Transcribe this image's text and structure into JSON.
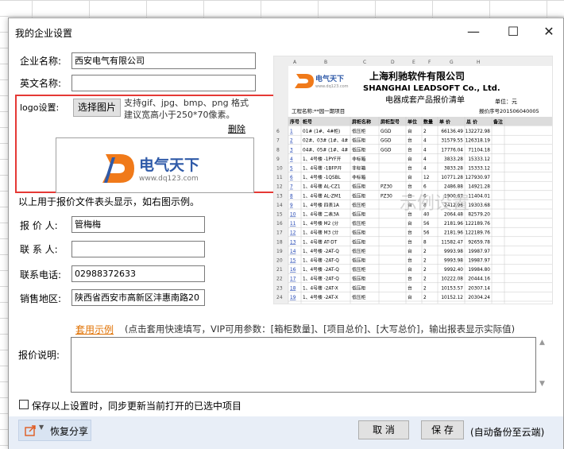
{
  "dialog": {
    "title": "我的企业设置",
    "minimize": "—",
    "maximize": "☐",
    "close": "✕"
  },
  "form": {
    "company_name_label": "企业名称:",
    "company_name_value": "西安电气有限公司",
    "english_name_label": "英文名称:",
    "english_name_value": "",
    "logo_label": "logo设置:",
    "choose_image_button": "选择图片",
    "logo_hint": "支持gif、jpg、bmp、png 格式 建议宽高小于250*70像素。",
    "delete_link": "删除",
    "logo_brand_cn": "电气天下",
    "logo_brand_url": "www.dq123.com",
    "usage_note": "以上用于报价文件表头显示，如右图示例。",
    "quoter_label": "报 价 人:",
    "quoter_value": "管梅梅",
    "contact_label": "联 系 人:",
    "contact_value": "",
    "phone_label": "联系电话:",
    "phone_value": "02988372633",
    "region_label": "销售地区:",
    "region_value": "陕西省西安市高新区沣惠南路20",
    "apply_example_link": "套用示例",
    "apply_example_note": "(点击套用快速填写，VIP可用参数：[箱柜数量]、[项目总价]、[大写总价]，输出报表显示实际值)",
    "quote_desc_label": "报价说明:",
    "sync_checkbox_label": "保存以上设置时，同步更新当前打开的已选中项目"
  },
  "footer": {
    "share_button": "恢复分享",
    "cancel_button": "取 消",
    "save_button": "保 存",
    "cloud_note": "(自动备份至云端)"
  },
  "preview": {
    "company_cn": "上海利驰软件有限公司",
    "company_en": "SHANGHAI LEADSOFT Co., Ltd.",
    "doc_title": "电器成套产品报价清单",
    "unit_note": "单位：元",
    "project_note": "工程名称:**园一期项目",
    "quote_no": "报价序号201506040005",
    "watermark": "示例设置",
    "logo_small": "电气天下",
    "logo_small_url": "www.dq123.com",
    "col_letters": [
      "A",
      "B",
      "C",
      "D",
      "E",
      "F",
      "G",
      "H"
    ],
    "headers": [
      "序号",
      "柜号",
      "屏柜名称",
      "屏柜型号",
      "单位",
      "数量",
      "单 价",
      "总 价",
      "备注"
    ],
    "rows": [
      [
        "1",
        "01# (1#、4#柜)",
        "低压柜",
        "GGD",
        "台",
        "2",
        "66136.49",
        "132272.98"
      ],
      [
        "2",
        "02#、03# (1#、4#",
        "低压柜",
        "GGD",
        "台",
        "4",
        "31579.55",
        "126318.19"
      ],
      [
        "3",
        "04#、05# (1#、4#",
        "低压柜",
        "GGD",
        "台",
        "4",
        "17776.04",
        "71104.18"
      ],
      [
        "4",
        "1、4号楼 -1PYF开",
        "非标箱",
        "",
        "台",
        "4",
        "3833.28",
        "15333.12"
      ],
      [
        "5",
        "1、4号楼 -1BFP开",
        "非标箱",
        "",
        "台",
        "4",
        "3833.28",
        "15333.12"
      ],
      [
        "6",
        "1、4号楼 -1QSBL",
        "非标箱",
        "",
        "台",
        "12",
        "10771.28",
        "127930.97"
      ],
      [
        "7",
        "1、4号楼 AL-CZ1",
        "低压柜",
        "PZ30",
        "台",
        "6",
        "2486.88",
        "14921.28"
      ],
      [
        "8",
        "1、4号楼 AL-ZM1",
        "低压柜",
        "PZ30",
        "台",
        "6",
        "1900.67",
        "11404.01"
      ],
      [
        "9",
        "1、4号楼 四表1A",
        "低压柜",
        "",
        "台",
        "8",
        "2412.96",
        "19303.68"
      ],
      [
        "10",
        "1、4号楼 二表3A",
        "低压柜",
        "",
        "台",
        "40",
        "2064.48",
        "82579.20"
      ],
      [
        "11",
        "1、4号楼 M2 (分",
        "低压柜",
        "",
        "台",
        "56",
        "2181.96",
        "122189.76"
      ],
      [
        "12",
        "1、4号楼 M3 (分",
        "低压柜",
        "",
        "台",
        "56",
        "2181.96",
        "122189.76"
      ],
      [
        "13",
        "1、4号楼 AT-DT",
        "低压柜",
        "",
        "台",
        "8",
        "11582.47",
        "92659.78"
      ],
      [
        "14",
        "1、4号楼 -2AT-Q",
        "低压柜",
        "",
        "台",
        "2",
        "9993.98",
        "19987.97"
      ],
      [
        "15",
        "1、4号楼 -2AT-Q",
        "低压柜",
        "",
        "台",
        "2",
        "9993.98",
        "19987.97"
      ],
      [
        "16",
        "1、4号楼 -2AT-Q",
        "低压柜",
        "",
        "台",
        "2",
        "9992.40",
        "19984.80"
      ],
      [
        "17",
        "1、4号楼 -2AT-Q",
        "低压柜",
        "",
        "台",
        "2",
        "10222.08",
        "20444.16"
      ],
      [
        "18",
        "1、4号楼 -2AT-X",
        "低压柜",
        "",
        "台",
        "2",
        "10153.57",
        "20307.14"
      ],
      [
        "19",
        "1、4号楼 -2AT-X",
        "低压柜",
        "",
        "台",
        "2",
        "10152.12",
        "20304.24"
      ]
    ]
  },
  "colors": {
    "highlight_border": "#e53935",
    "link_orange": "#e07000",
    "logo_orange": "#f07a1a",
    "logo_blue": "#2f5aa8",
    "bottom_bar": "#e8eef7"
  }
}
